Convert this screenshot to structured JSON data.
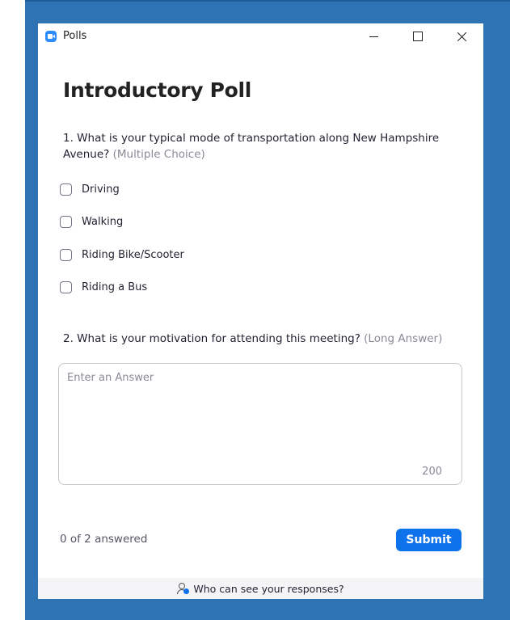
{
  "window": {
    "title": "Polls"
  },
  "poll": {
    "title": "Introductory Poll",
    "questions": [
      {
        "text": "1. What is your typical mode of transportation along New Hampshire Avenue?",
        "type": "(Multiple Choice)",
        "options": [
          "Driving",
          "Walking",
          "Riding Bike/Scooter",
          "Riding a Bus"
        ]
      },
      {
        "text": "2. What is your motivation for attending this meeting?",
        "type": "(Long Answer)",
        "placeholder": "Enter an Answer",
        "char_limit": "200"
      }
    ]
  },
  "status": {
    "answered": "0 of 2 answered"
  },
  "actions": {
    "submit_label": "Submit"
  },
  "footer": {
    "text": "Who can see your responses?"
  },
  "colors": {
    "frame": "#2e74b5",
    "accent": "#0e72ed",
    "app_icon": "#2d8cff"
  }
}
